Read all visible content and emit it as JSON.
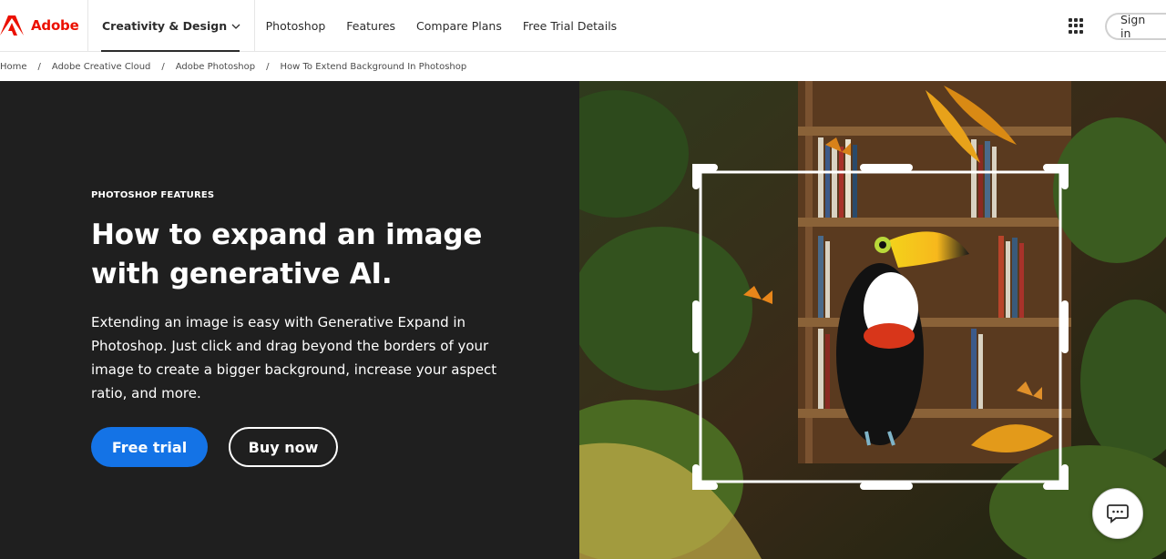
{
  "brand": {
    "name": "Adobe",
    "logo_icon": "adobe-logo-icon",
    "color": "#eb1000"
  },
  "nav": {
    "primary_item": "Creativity & Design",
    "items": [
      "Photoshop",
      "Features",
      "Compare Plans",
      "Free Trial Details"
    ],
    "apps_icon": "app-switcher-grid-icon",
    "signin_label": "Sign in"
  },
  "breadcrumb": [
    "Home",
    "Adobe Creative Cloud",
    "Adobe Photoshop",
    "How To Extend Background In Photoshop"
  ],
  "hero": {
    "eyebrow": "PHOTOSHOP FEATURES",
    "headline": "How to expand an image with generative AI.",
    "body": "Extending an image is easy with Generative Expand in Photoshop. Just click and drag beyond the borders of your image to create a bigger background, increase your aspect ratio, and more.",
    "primary_cta": "Free trial",
    "secondary_cta": "Buy now",
    "image_subject": "toucan-on-bookshelf-with-crop-frame",
    "accent_color": "#1473e6",
    "background_color": "#1f1f1f"
  },
  "chat": {
    "icon": "chat-bubble-icon"
  }
}
